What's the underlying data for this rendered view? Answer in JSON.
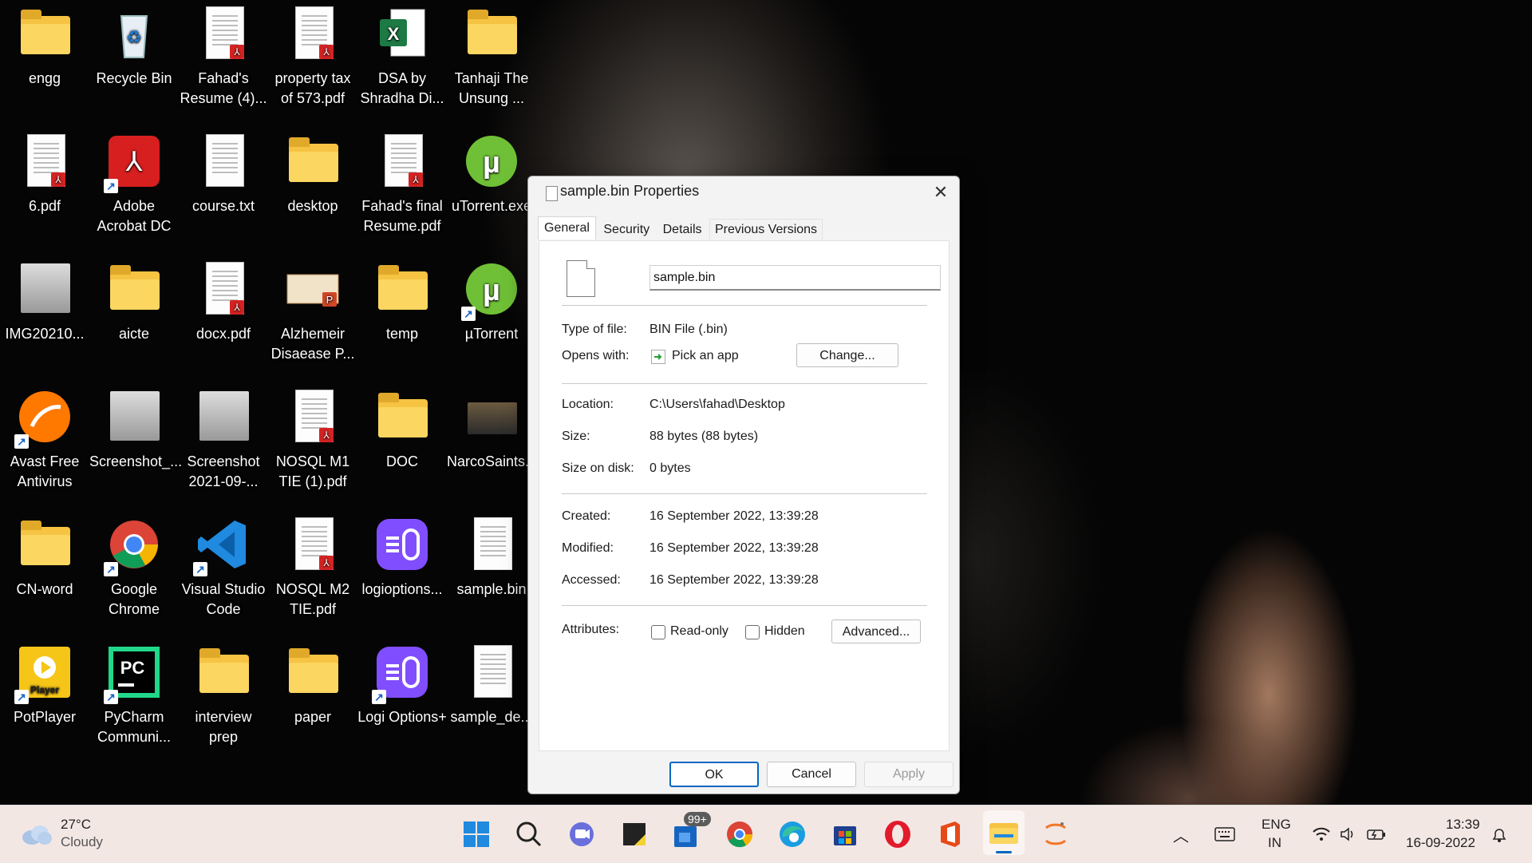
{
  "desktop": {
    "icons": [
      {
        "label": "engg",
        "icon": "folder-icon"
      },
      {
        "label": "Recycle Bin",
        "icon": "recycle-bin-icon"
      },
      {
        "label": "Fahad's Resume (4)...",
        "icon": "pdf-document-icon"
      },
      {
        "label": "property tax of 573.pdf",
        "icon": "pdf-document-icon"
      },
      {
        "label": "DSA by Shradha Di...",
        "icon": "excel-icon"
      },
      {
        "label": "Tanhaji The Unsung ...",
        "icon": "folder-icon"
      },
      {
        "label": "6.pdf",
        "icon": "pdf-document-icon"
      },
      {
        "label": "Adobe Acrobat DC",
        "icon": "acrobat-icon"
      },
      {
        "label": "course.txt",
        "icon": "text-document-icon"
      },
      {
        "label": "desktop",
        "icon": "folder-icon"
      },
      {
        "label": "Fahad's final Resume.pdf",
        "icon": "pdf-document-icon"
      },
      {
        "label": "uTorrent.exe",
        "icon": "utorrent-icon"
      },
      {
        "label": "IMG20210...",
        "icon": "image-icon"
      },
      {
        "label": "aicte",
        "icon": "folder-icon"
      },
      {
        "label": "docx.pdf",
        "icon": "pdf-document-icon"
      },
      {
        "label": "Alzhemeir Disaease P...",
        "icon": "powerpoint-icon"
      },
      {
        "label": "temp",
        "icon": "folder-icon"
      },
      {
        "label": "µTorrent",
        "icon": "utorrent-icon"
      },
      {
        "label": "Avast Free Antivirus",
        "icon": "avast-icon"
      },
      {
        "label": "Screenshot_...",
        "icon": "image-icon"
      },
      {
        "label": "Screenshot 2021-09-...",
        "icon": "image-icon"
      },
      {
        "label": "NOSQL M1 TIE (1).pdf",
        "icon": "pdf-document-icon"
      },
      {
        "label": "DOC",
        "icon": "folder-icon"
      },
      {
        "label": "NarcoSaints...",
        "icon": "video-icon"
      },
      {
        "label": "CN-word",
        "icon": "folder-icon"
      },
      {
        "label": "Google Chrome",
        "icon": "chrome-icon"
      },
      {
        "label": "Visual Studio Code",
        "icon": "vscode-icon"
      },
      {
        "label": "NOSQL M2 TIE.pdf",
        "icon": "pdf-document-icon"
      },
      {
        "label": "logioptions...",
        "icon": "logi-icon"
      },
      {
        "label": "sample.bin",
        "icon": "blank-file-icon"
      },
      {
        "label": "PotPlayer",
        "icon": "potplayer-icon"
      },
      {
        "label": "PyCharm Communi...",
        "icon": "pycharm-icon"
      },
      {
        "label": "interview prep",
        "icon": "folder-icon"
      },
      {
        "label": "paper",
        "icon": "folder-icon"
      },
      {
        "label": "Logi Options+",
        "icon": "logi-icon"
      },
      {
        "label": "sample_de...",
        "icon": "text-document-icon"
      }
    ]
  },
  "dialog": {
    "title": "sample.bin Properties",
    "tabs": [
      "General",
      "Security",
      "Details",
      "Previous Versions"
    ],
    "file_name": "sample.bin",
    "type_label": "Type of file:",
    "type_value": "BIN File (.bin)",
    "opens_label": "Opens with:",
    "opens_value": "Pick an app",
    "change_button": "Change...",
    "location_label": "Location:",
    "location_value": "C:\\Users\\fahad\\Desktop",
    "size_label": "Size:",
    "size_value": "88 bytes (88 bytes)",
    "size_disk_label": "Size on disk:",
    "size_disk_value": "0 bytes",
    "created_label": "Created:",
    "created_value": "16 September 2022, 13:39:28",
    "modified_label": "Modified:",
    "modified_value": "16 September 2022, 13:39:28",
    "accessed_label": "Accessed:",
    "accessed_value": "16 September 2022, 13:39:28",
    "attributes_label": "Attributes:",
    "readonly_label": "Read-only",
    "hidden_label": "Hidden",
    "advanced_button": "Advanced...",
    "ok_button": "OK",
    "cancel_button": "Cancel",
    "apply_button": "Apply"
  },
  "taskbar": {
    "weather_temp": "27°C",
    "weather_desc": "Cloudy",
    "mail_badge": "99+",
    "lang_top": "ENG",
    "lang_bottom": "IN",
    "time": "13:39",
    "date": "16-09-2022",
    "accent": "#0078d4"
  }
}
